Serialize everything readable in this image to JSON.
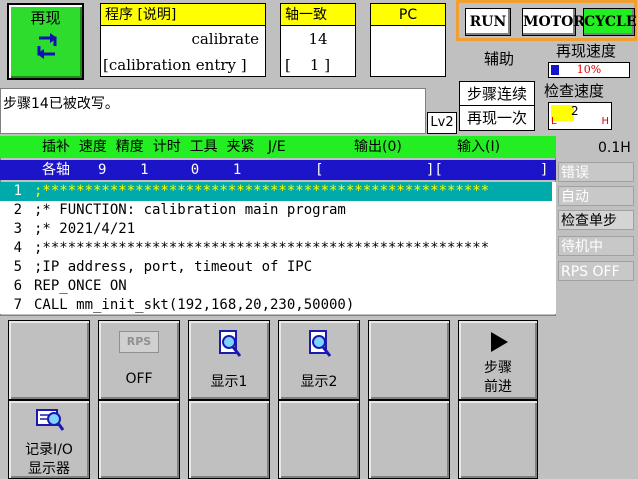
{
  "mode": {
    "label": "再现"
  },
  "program_panel": {
    "header": "程序 [说明]",
    "name": "calibrate",
    "comment": "[calibration entry ]"
  },
  "axis_panel": {
    "header": "轴一致",
    "value": "14",
    "sub": "[    1 ]"
  },
  "pc_panel": {
    "header": "PC",
    "value": ""
  },
  "status": {
    "run": "RUN",
    "motor": "MOTOR",
    "cycle": "CYCLE",
    "run_color": "#ffffff",
    "motor_color": "#ffffff",
    "cycle_color": "#22ee22"
  },
  "aux": {
    "label": "辅助"
  },
  "repeat_speed": {
    "label": "再现速度",
    "value": "10%",
    "fill_fraction": 0.1
  },
  "check_speed": {
    "label": "检查速度",
    "value": "2",
    "low": "L",
    "high": "H",
    "fill_fraction": 0.4
  },
  "step_mode": {
    "continuous": "步骤连续",
    "once": "再现一次"
  },
  "message": "步骤14已被改写。",
  "level": "Lv2",
  "header": {
    "columns": "插补  速度  精度  计时  工具  夹紧   J/E",
    "output": "输出(0)",
    "input": "输入(I)"
  },
  "axes_row": {
    "label": "各轴",
    "values": "9    1     0    1",
    "bracket_open": "[",
    "bracket_mid": "][",
    "bracket_close": "]"
  },
  "timer": "0.1H",
  "code_lines": [
    {
      "num": "1",
      "text": ";*****************************************************"
    },
    {
      "num": "2",
      "text": ";* FUNCTION: calibration main program"
    },
    {
      "num": "3",
      "text": ";* 2021/4/21"
    },
    {
      "num": "4",
      "text": ";*****************************************************"
    },
    {
      "num": "5",
      "text": ";IP address, port, timeout of IPC"
    },
    {
      "num": "6",
      "text": "REP_ONCE ON"
    },
    {
      "num": "7",
      "text": "CALL mm_init_skt(192,168,20,230,50000)"
    }
  ],
  "states": {
    "error": "错误",
    "auto": "自动",
    "check_step": "检查单步",
    "waiting": "待机中",
    "rps_off": "RPS OFF"
  },
  "fbuttons": {
    "rps_icon": "RPS",
    "rps_label": "OFF",
    "display1": "显示1",
    "display2": "显示2",
    "step_forward_line1": "步骤",
    "step_forward_line2": "前进",
    "io_monitor_line1": "记录I/O",
    "io_monitor_line2": "显示器"
  }
}
